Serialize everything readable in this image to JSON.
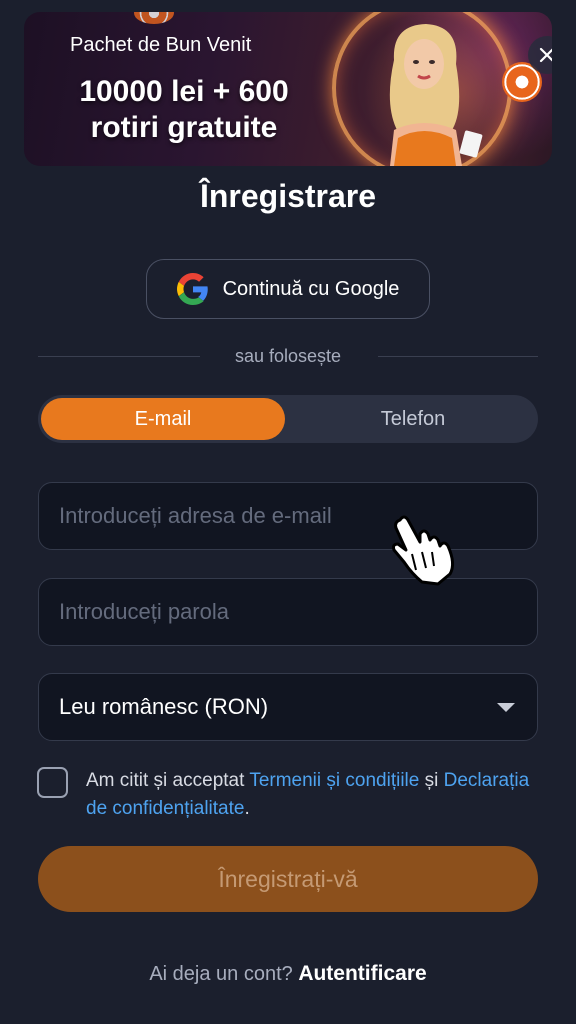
{
  "banner": {
    "subtitle": "Pachet de Bun Venit",
    "headline": "10000 lei + 600 rotiri gratuite",
    "close_icon": "close-icon"
  },
  "page_title": "Înregistrare",
  "google_button": {
    "label": "Continuă cu Google",
    "icon": "google-icon"
  },
  "divider_text": "sau folosește",
  "tabs": [
    {
      "label": "E-mail",
      "active": true
    },
    {
      "label": "Telefon",
      "active": false
    }
  ],
  "email_field": {
    "placeholder": "Introduceți adresa de e-mail",
    "value": ""
  },
  "password_field": {
    "placeholder": "Introduceți parola",
    "value": ""
  },
  "currency_select": {
    "selected": "Leu românesc (RON)",
    "icon": "chevron-down-icon"
  },
  "consent": {
    "checked": false,
    "prefix": "Am citit și acceptat",
    "terms_link": "Termenii și condițiile",
    "conjunction": "și",
    "privacy_link": "Declarația de confidențialitate",
    "suffix": "."
  },
  "submit_button": {
    "label": "Înregistrați-vă",
    "enabled": false
  },
  "footer": {
    "prompt": "Ai deja un cont?",
    "login_link": "Autentificare"
  },
  "colors": {
    "background": "#1b1f2d",
    "accent": "#e8791e",
    "accent_disabled": "#8c501c",
    "link": "#4ea3f0",
    "field_background": "#111521"
  }
}
